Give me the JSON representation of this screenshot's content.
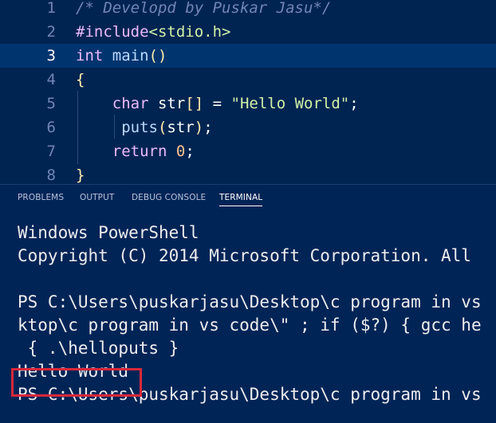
{
  "editor": {
    "lines": [
      {
        "num": "1",
        "segments": [
          {
            "t": "/* Developd by Puskar Jasu*/",
            "c": "comment"
          }
        ]
      },
      {
        "num": "2",
        "segments": [
          {
            "t": "#include",
            "c": "keyword"
          },
          {
            "t": "<stdio.h>",
            "c": "include-path"
          }
        ]
      },
      {
        "num": "3",
        "current": true,
        "segments": [
          {
            "t": "int",
            "c": "type"
          },
          {
            "t": " ",
            "c": "punct"
          },
          {
            "t": "main",
            "c": "func"
          },
          {
            "t": "()",
            "c": "bracket"
          }
        ]
      },
      {
        "num": "4",
        "segments": [
          {
            "t": "{",
            "c": "bracket"
          }
        ]
      },
      {
        "num": "5",
        "segments": [
          {
            "t": "    ",
            "c": "punct"
          },
          {
            "t": "char",
            "c": "type"
          },
          {
            "t": " ",
            "c": "punct"
          },
          {
            "t": "str",
            "c": "var"
          },
          {
            "t": "[]",
            "c": "bracket"
          },
          {
            "t": " = ",
            "c": "punct"
          },
          {
            "t": "\"Hello World\"",
            "c": "string"
          },
          {
            "t": ";",
            "c": "punct"
          }
        ]
      },
      {
        "num": "6",
        "segments": [
          {
            "t": "     ",
            "c": "punct"
          },
          {
            "t": "puts",
            "c": "func"
          },
          {
            "t": "(",
            "c": "bracket"
          },
          {
            "t": "str",
            "c": "var"
          },
          {
            "t": ")",
            "c": "bracket"
          },
          {
            "t": ";",
            "c": "punct"
          }
        ]
      },
      {
        "num": "7",
        "segments": [
          {
            "t": "    ",
            "c": "punct"
          },
          {
            "t": "return",
            "c": "keyword"
          },
          {
            "t": " ",
            "c": "punct"
          },
          {
            "t": "0",
            "c": "number"
          },
          {
            "t": ";",
            "c": "punct"
          }
        ]
      },
      {
        "num": "8",
        "segments": [
          {
            "t": "}",
            "c": "bracket"
          }
        ]
      }
    ]
  },
  "panel": {
    "tabs": [
      {
        "label": "PROBLEMS",
        "active": false
      },
      {
        "label": "OUTPUT",
        "active": false
      },
      {
        "label": "DEBUG CONSOLE",
        "active": false
      },
      {
        "label": "TERMINAL",
        "active": true
      }
    ]
  },
  "terminal": {
    "lines": [
      "",
      "Windows PowerShell",
      "Copyright (C) 2014 Microsoft Corporation. All",
      "",
      "PS C:\\Users\\puskarjasu\\Desktop\\c program in vs",
      "ktop\\c program in vs code\\\" ; if ($?) { gcc he",
      " { .\\helloputs }",
      "Hello World",
      "PS C:\\Users\\puskarjasu\\Desktop\\c program in vs"
    ],
    "highlighted_output": "Hello World"
  },
  "colors": {
    "editor_bg": "#002451",
    "terminal_bg": "#012456",
    "highlight_border": "#d9283a"
  }
}
